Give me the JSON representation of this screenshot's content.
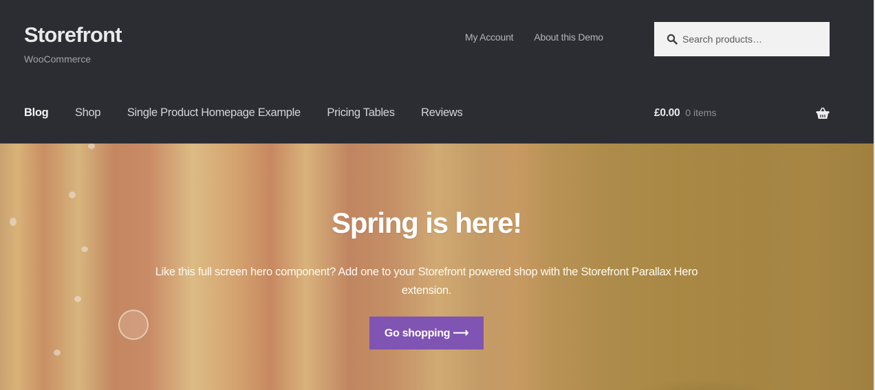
{
  "header": {
    "site_title": "Storefront",
    "tagline": "WooCommerce",
    "secondary_nav": [
      {
        "label": "My Account"
      },
      {
        "label": "About this Demo"
      }
    ],
    "search": {
      "placeholder": "Search products…",
      "value": "",
      "icon": "search-icon"
    },
    "primary_nav": [
      {
        "label": "Blog",
        "active": true
      },
      {
        "label": "Shop"
      },
      {
        "label": "Single Product Homepage Example"
      },
      {
        "label": "Pricing Tables"
      },
      {
        "label": "Reviews"
      }
    ],
    "cart": {
      "amount": "£0.00",
      "count": "0 items",
      "icon": "basket-icon"
    }
  },
  "hero": {
    "title": "Spring is here!",
    "text": "Like this full screen hero component? Add one to your Storefront powered shop with the Storefront Parallax Hero extension.",
    "button_label": "Go shopping ⟶"
  },
  "colors": {
    "header_bg": "#2c2d33",
    "button_bg": "#7f54b3",
    "search_bg": "#f2f2f2"
  }
}
